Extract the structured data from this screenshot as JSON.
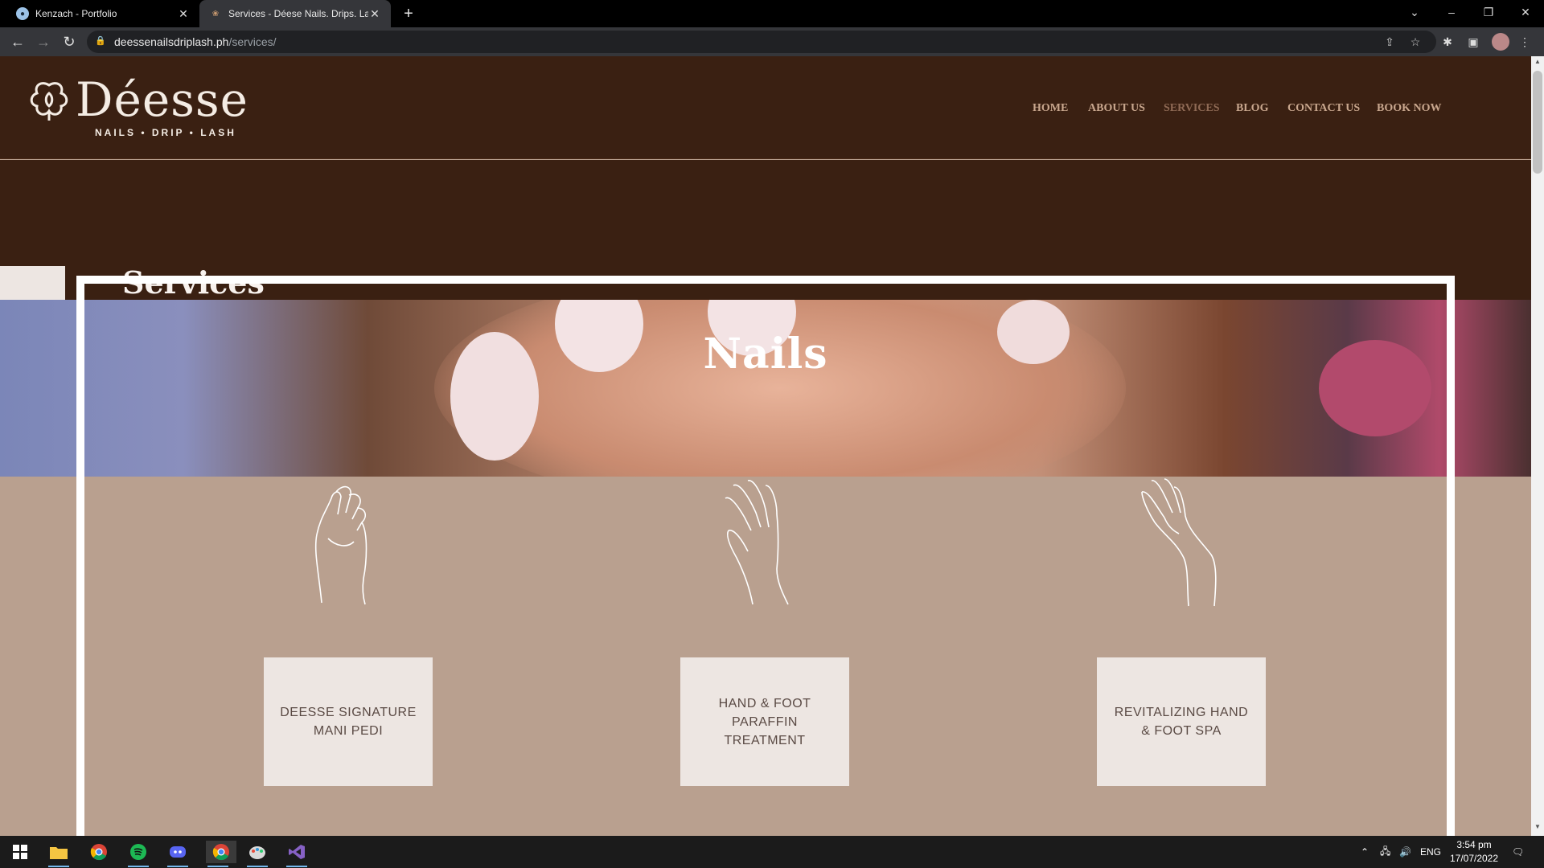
{
  "browser": {
    "tabs": [
      {
        "title": "Kenzach - Portfolio",
        "active": false
      },
      {
        "title": "Services - Déese Nails. Drips. Lash",
        "active": true
      }
    ],
    "url_host": "deessenailsdriplash.ph",
    "url_path": "/services/",
    "new_tab": "+",
    "back": "←",
    "forward": "→",
    "reload": "↻"
  },
  "site": {
    "logo_name": "Déesse",
    "logo_tagline": "NAILS • DRIP • LASH",
    "nav": [
      {
        "label": "HOME",
        "active": false
      },
      {
        "label": "ABOUT US",
        "active": false
      },
      {
        "label": "SERVICES",
        "active": true
      },
      {
        "label": "BLOG",
        "active": false
      },
      {
        "label": "CONTACT US",
        "active": false
      },
      {
        "label": "BOOK NOW",
        "active": false
      }
    ],
    "page_title": "Services",
    "section_title": "Nails",
    "services": [
      {
        "name": "DEESSE SIGNATURE MANI PEDI"
      },
      {
        "name": "HAND & FOOT PARAFFIN TREATMENT"
      },
      {
        "name": "REVITALIZING HAND & FOOT SPA"
      }
    ]
  },
  "colors": {
    "header_bg": "#3a2012",
    "nav_text": "#c9a78e",
    "nav_active": "#8f6a55",
    "section_bg": "#b9a08f",
    "card_bg": "#ede6e2"
  },
  "taskbar": {
    "language": "ENG",
    "time": "3:54 pm",
    "date": "17/07/2022",
    "apps": [
      "start-icon",
      "file-explorer-icon",
      "chrome-icon",
      "spotify-icon",
      "discord-icon",
      "chrome-icon",
      "paint-icon",
      "visual-studio-icon"
    ]
  }
}
